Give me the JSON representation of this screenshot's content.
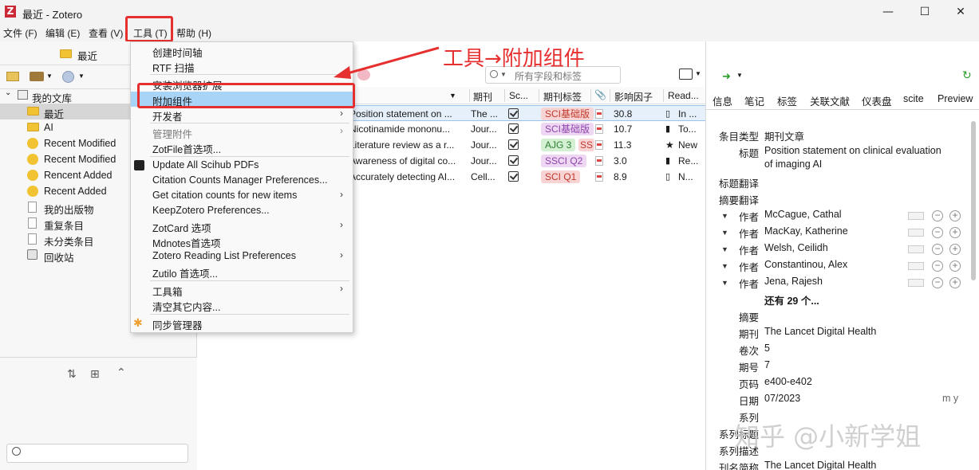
{
  "window": {
    "title": "最近 - Zotero",
    "logo": "Z",
    "min": "—",
    "max": "☐",
    "close": "✕"
  },
  "menubar": [
    "文件 (F)",
    "编辑 (E)",
    "查看 (V)",
    "工具 (T)",
    "帮助 (H)"
  ],
  "left": {
    "header": "最近",
    "tree": [
      {
        "label": "我的文库",
        "icon": "library-icon",
        "caret": "⌄"
      },
      {
        "label": "最近",
        "icon": "folder-icon",
        "selected": true
      },
      {
        "label": "AI",
        "icon": "folder-icon"
      },
      {
        "label": "Recent Modified",
        "icon": "saved-search-icon"
      },
      {
        "label": "Recent Modified",
        "icon": "saved-search-icon"
      },
      {
        "label": "Rencent Added",
        "icon": "saved-search-icon"
      },
      {
        "label": "Recent Added",
        "icon": "saved-search-icon"
      },
      {
        "label": "我的出版物",
        "icon": "publications-icon"
      },
      {
        "label": "重复条目",
        "icon": "duplicates-icon"
      },
      {
        "label": "未分类条目",
        "icon": "unfiled-icon"
      },
      {
        "label": "回收站",
        "icon": "trash-icon"
      }
    ]
  },
  "toolbar": {
    "search_placeholder": "所有字段和标签"
  },
  "columns": {
    "title": "",
    "journal": "期刊",
    "sc": "Sc...",
    "journal_tags": "期刊标签",
    "impact": "影响因子",
    "read": "Read..."
  },
  "items": [
    {
      "title": "Position statement on ...",
      "journal": "The ...",
      "tag": "SCI基础版",
      "tag_color": "#f9d4d4",
      "tag_text": "#c0392b",
      "impact": "30.8",
      "read": "In ...",
      "read_icon": "book-icon",
      "selected": true
    },
    {
      "title": "Nicotinamide mononu...",
      "journal": "Jour...",
      "tag": "SCI基础版",
      "tag_color": "#eed7f2",
      "tag_text": "#8e44ad",
      "impact": "10.7",
      "read": "To...",
      "read_icon": "book-icon"
    },
    {
      "title": "Literature review as a r...",
      "journal": "Jour...",
      "tag": "AJG 3",
      "tag_color": "#d3f0d3",
      "tag_text": "#2e7d32",
      "tag2": "SS",
      "impact": "11.3",
      "read": "New",
      "read_icon": "star-icon"
    },
    {
      "title": "Awareness of digital co...",
      "journal": "Jour...",
      "tag": "SSCI Q2",
      "tag_color": "#eed7f2",
      "tag_text": "#8e44ad",
      "impact": "3.0",
      "read": "Re...",
      "read_icon": "book-icon"
    },
    {
      "title": "Accurately detecting AI...",
      "journal": "Cell...",
      "tag": "SCI Q1",
      "tag_color": "#f9d4d4",
      "tag_text": "#c0392b",
      "impact": "8.9",
      "read": "N...",
      "read_icon": "page-icon"
    }
  ],
  "right": {
    "tabs": [
      "信息",
      "笔记",
      "标签",
      "关联文献",
      "仪表盘",
      "scite",
      "Preview"
    ],
    "fields": {
      "item_type_label": "条目类型",
      "item_type": "期刊文章",
      "title_label": "标题",
      "title_line1": "Position statement on clinical evaluation",
      "title_line2": "of imaging AI",
      "title_trans_label": "标题翻译",
      "abstract_trans_label": "摘要翻译",
      "author_label": "作者",
      "authors": [
        "McCague, Cathal",
        "MacKay, Katherine",
        "Welsh, Ceilidh",
        "Constantinou, Alex",
        "Jena, Rajesh"
      ],
      "more_authors": "还有 29 个...",
      "abstract_label": "摘要",
      "publication_label": "期刊",
      "publication": "The Lancet Digital Health",
      "volume_label": "卷次",
      "volume": "5",
      "issue_label": "期号",
      "issue": "7",
      "pages_label": "页码",
      "pages": "e400-e402",
      "date_label": "日期",
      "date": "07/2023",
      "date_fmt": "m y",
      "series_label": "系列",
      "series_title_label": "系列标题",
      "series_desc_label": "系列描述",
      "journal_abbr_label": "刊名简称",
      "journal_abbr": "The Lancet Digital Health"
    }
  },
  "dropdown": [
    {
      "label": "创建时间轴"
    },
    {
      "label": "RTF 扫描"
    },
    {
      "sep": true
    },
    {
      "label": "安装浏览器扩展"
    },
    {
      "label": "附加组件",
      "highlighted": true
    },
    {
      "label": "开发者",
      "submenu": true
    },
    {
      "sep": true
    },
    {
      "label": "管理附件",
      "submenu": true,
      "disabled": true
    },
    {
      "label": "ZotFile首选项..."
    },
    {
      "sep": true
    },
    {
      "label": "Update All Scihub PDFs",
      "icon": "scihub-icon"
    },
    {
      "label": "Citation Counts Manager Preferences..."
    },
    {
      "label": "Get citation counts for new items",
      "submenu": true
    },
    {
      "label": "KeepZotero Preferences..."
    },
    {
      "label": "ZotCard 选项",
      "submenu": true
    },
    {
      "label": "Mdnotes首选项"
    },
    {
      "label": "Zotero Reading List Preferences",
      "submenu": true
    },
    {
      "label": "Zutilo 首选项..."
    },
    {
      "sep": true
    },
    {
      "label": "工具箱",
      "submenu": true
    },
    {
      "label": "清空其它内容..."
    },
    {
      "sep": true
    },
    {
      "label": "同步管理器",
      "icon": "sync-manager-icon"
    }
  ],
  "annotation": "工具→附加组件",
  "watermark": "知乎 @小新学姐",
  "colors": {
    "accent": "#e63030",
    "highlight": "#a8d4f7",
    "selection": "#e6f0fb"
  }
}
